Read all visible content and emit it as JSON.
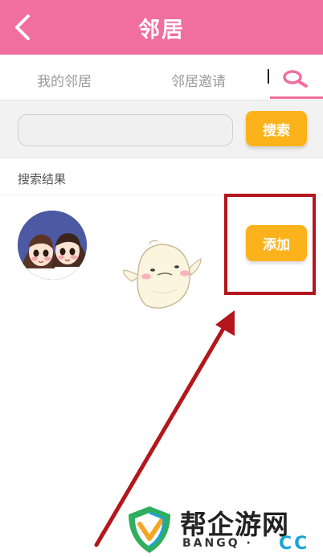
{
  "header": {
    "title": "邻居",
    "back_icon": "chevron-left-icon"
  },
  "tabs": [
    {
      "label": "我的邻居"
    },
    {
      "label": "邻居邀请"
    }
  ],
  "search_tab_icon": "search-icon",
  "search": {
    "value": "",
    "placeholder": "",
    "button_label": "搜索"
  },
  "results": {
    "label": "搜索结果",
    "items": [
      {
        "action_label": "添加"
      }
    ]
  },
  "colors": {
    "header": "#f06f9d",
    "button": "#fcb31b",
    "annotation": "#b3161c",
    "watermark_accent": "#1aa3d4"
  },
  "watermark": {
    "title": "帮企游网",
    "subtitle": "BANGQ · ",
    "cc": "CC"
  }
}
